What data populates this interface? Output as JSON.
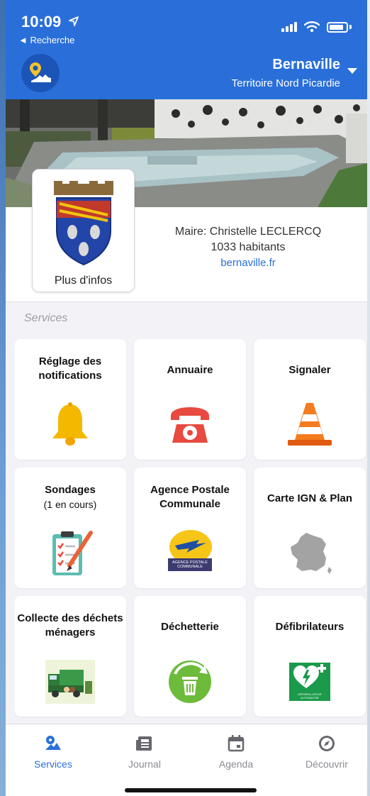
{
  "status": {
    "time": "10:09",
    "back_label": "◄ Recherche"
  },
  "header": {
    "town": "Bernaville",
    "region": "Territoire Nord Picardie"
  },
  "info": {
    "crest_label": "Plus d'infos",
    "mayor": "Maire: Christelle LECLERCQ",
    "population": "1033 habitants",
    "website": "bernaville.fr"
  },
  "services": {
    "section_title": "Services",
    "tiles": [
      {
        "title": "Réglage des notifications",
        "icon": "bell-icon"
      },
      {
        "title": "Annuaire",
        "icon": "telephone-icon"
      },
      {
        "title": "Signaler",
        "icon": "traffic-cone-icon"
      },
      {
        "title": "Sondages",
        "subtitle": "(1 en cours)",
        "icon": "clipboard-checklist-icon"
      },
      {
        "title": "Agence Postale Communale",
        "icon": "la-poste-logo-icon",
        "logo_text": "AGENCE POSTALE COMMUNALE"
      },
      {
        "title": "Carte IGN & Plan",
        "icon": "france-map-icon"
      },
      {
        "title": "Collecte des déchets ménagers",
        "icon": "garbage-truck-icon"
      },
      {
        "title": "Déchetterie",
        "icon": "recycling-bin-icon"
      },
      {
        "title": "Défibrilateurs",
        "icon": "defibrillator-icon",
        "logo_text": "DÉFIBRILLATEUR AUTOMATISÉ"
      }
    ]
  },
  "tabs": [
    {
      "label": "Services",
      "icon": "services-icon",
      "active": true
    },
    {
      "label": "Journal",
      "icon": "newspaper-icon",
      "active": false
    },
    {
      "label": "Agenda",
      "icon": "calendar-icon",
      "active": false
    },
    {
      "label": "Découvrir",
      "icon": "compass-icon",
      "active": false
    }
  ],
  "colors": {
    "accent": "#2a6fd9",
    "tile_bg": "#ffffff",
    "page_bg": "#f2f2f7"
  }
}
